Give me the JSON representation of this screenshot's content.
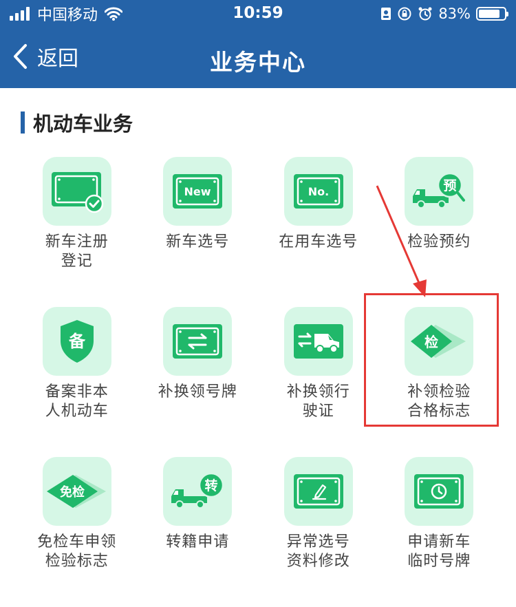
{
  "status_bar": {
    "carrier": "中国移动",
    "time": "10:59",
    "battery_percent": "83%",
    "battery_level": 0.83
  },
  "nav": {
    "back_label": "返回",
    "title": "业务中心"
  },
  "section": {
    "title": "机动车业务"
  },
  "services": [
    {
      "line1": "新车注册",
      "line2": "登记",
      "icon": "new-plate-check-icon"
    },
    {
      "line1": "新车选号",
      "line2": "",
      "icon": "new-plate-icon"
    },
    {
      "line1": "在用车选号",
      "line2": "",
      "icon": "no-plate-icon"
    },
    {
      "line1": "检验预约",
      "line2": "",
      "icon": "truck-reserve-icon",
      "badge": "预"
    },
    {
      "line1": "备案非本",
      "line2": "人机动车",
      "icon": "shield-icon",
      "badge": "备"
    },
    {
      "line1": "补换领号牌",
      "line2": "",
      "icon": "plate-exchange-icon"
    },
    {
      "line1": "补换领行",
      "line2": "驶证",
      "icon": "vehicle-exchange-icon"
    },
    {
      "line1": "补领检验",
      "line2": "合格标志",
      "icon": "inspection-tag-icon",
      "badge": "检"
    },
    {
      "line1": "免检车申领",
      "line2": "检验标志",
      "icon": "exempt-tag-icon",
      "badge": "免检"
    },
    {
      "line1": "转籍申请",
      "line2": "",
      "icon": "truck-transfer-icon",
      "badge": "转"
    },
    {
      "line1": "异常选号",
      "line2": "资料修改",
      "icon": "plate-edit-icon"
    },
    {
      "line1": "申请新车",
      "line2": "临时号牌",
      "icon": "plate-clock-icon"
    }
  ],
  "colors": {
    "header": "#2563a8",
    "tile_bg": "#d6f7e6",
    "icon_green": "#20b86a",
    "annotation": "#e53935"
  }
}
